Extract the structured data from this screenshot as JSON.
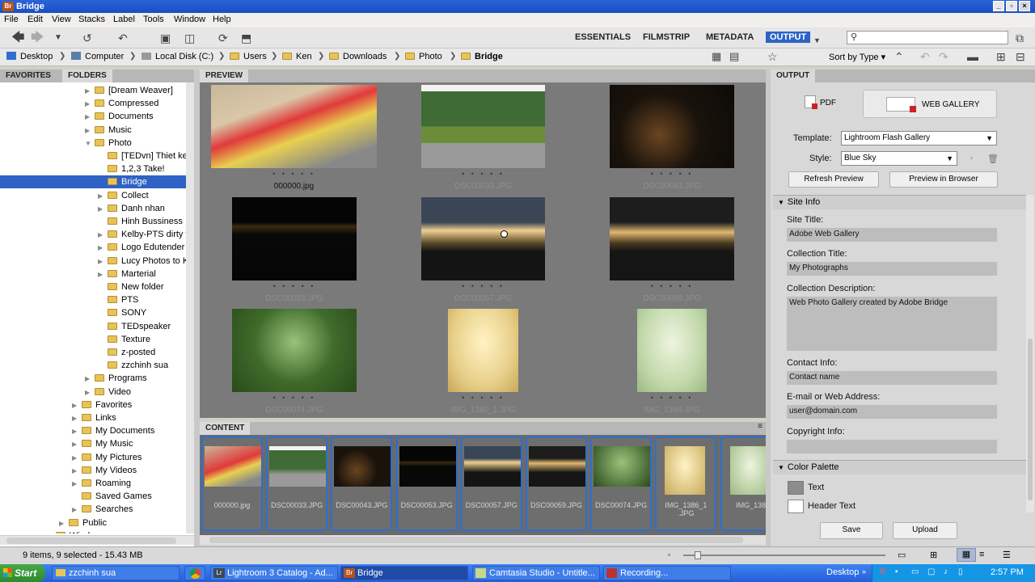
{
  "window": {
    "title": "Bridge",
    "app_icon": "Br"
  },
  "menu": [
    "File",
    "Edit",
    "View",
    "Stacks",
    "Label",
    "Tools",
    "Window",
    "Help"
  ],
  "workspaces": {
    "essentials": "ESSENTIALS",
    "filmstrip": "FILMSTRIP",
    "metadata": "METADATA",
    "output": "OUTPUT"
  },
  "path": {
    "items": [
      "Desktop",
      "Computer",
      "Local Disk (C:)",
      "Users",
      "Ken",
      "Downloads",
      "Photo",
      "Bridge"
    ],
    "sort": "Sort by Type"
  },
  "left": {
    "tabs": [
      "FAVORITES",
      "FOLDERS"
    ],
    "tree": [
      {
        "label": "[Dream Weaver]",
        "indent": 1,
        "arrow": true
      },
      {
        "label": "Compressed",
        "indent": 1,
        "arrow": true
      },
      {
        "label": "Documents",
        "indent": 1,
        "arrow": true
      },
      {
        "label": "Music",
        "indent": 1,
        "arrow": true
      },
      {
        "label": "Photo",
        "indent": 1,
        "arrow": true,
        "open": true
      },
      {
        "label": "[TEDvn] Thiet ke",
        "indent": 2,
        "arrow": false
      },
      {
        "label": "1,2,3 Take!",
        "indent": 2,
        "arrow": false
      },
      {
        "label": "Bridge",
        "indent": 2,
        "arrow": false,
        "selected": true
      },
      {
        "label": "Collect",
        "indent": 2,
        "arrow": true
      },
      {
        "label": "Danh nhan",
        "indent": 2,
        "arrow": true
      },
      {
        "label": "Hinh Bussiness",
        "indent": 2,
        "arrow": false
      },
      {
        "label": "Kelby-PTS dirty tric",
        "indent": 2,
        "arrow": true
      },
      {
        "label": "Logo Edutender",
        "indent": 2,
        "arrow": true
      },
      {
        "label": "Lucy Photos to Ken",
        "indent": 2,
        "arrow": true
      },
      {
        "label": "Marterial",
        "indent": 2,
        "arrow": true
      },
      {
        "label": "New folder",
        "indent": 2,
        "arrow": false
      },
      {
        "label": "PTS",
        "indent": 2,
        "arrow": false
      },
      {
        "label": "SONY",
        "indent": 2,
        "arrow": false
      },
      {
        "label": "TEDspeaker",
        "indent": 2,
        "arrow": false
      },
      {
        "label": "Texture",
        "indent": 2,
        "arrow": false
      },
      {
        "label": "z-posted",
        "indent": 2,
        "arrow": false
      },
      {
        "label": "zzchinh sua",
        "indent": 2,
        "arrow": false
      },
      {
        "label": "Programs",
        "indent": 1,
        "arrow": true
      },
      {
        "label": "Video",
        "indent": 1,
        "arrow": true
      },
      {
        "label": "Favorites",
        "indent": 0,
        "arrow": true
      },
      {
        "label": "Links",
        "indent": 0,
        "arrow": true
      },
      {
        "label": "My Documents",
        "indent": 0,
        "arrow": true
      },
      {
        "label": "My Music",
        "indent": 0,
        "arrow": true
      },
      {
        "label": "My Pictures",
        "indent": 0,
        "arrow": true
      },
      {
        "label": "My Videos",
        "indent": 0,
        "arrow": true
      },
      {
        "label": "Roaming",
        "indent": 0,
        "arrow": true
      },
      {
        "label": "Saved Games",
        "indent": 0,
        "arrow": false
      },
      {
        "label": "Searches",
        "indent": 0,
        "arrow": true
      },
      {
        "label": "Public",
        "indent": -1,
        "arrow": true
      },
      {
        "label": "Windows",
        "indent": -2,
        "arrow": true
      }
    ]
  },
  "preview": {
    "tab": "PREVIEW",
    "items": [
      {
        "name": "000000.jpg",
        "selected": true
      },
      {
        "name": "DSC00033.JPG"
      },
      {
        "name": "DSC00043.JPG"
      },
      {
        "name": "DSC00053.JPG"
      },
      {
        "name": "DSC00057.JPG"
      },
      {
        "name": "DSC00059.JPG"
      },
      {
        "name": "DSC00074.JPG"
      },
      {
        "name": "IMG_1380_1.JPG"
      },
      {
        "name": "IMG_1386.JPG"
      }
    ],
    "stars": "• • • • •"
  },
  "content": {
    "tab": "CONTENT",
    "items": [
      "000000.jpg",
      "DSC00033.JPG",
      "DSC00043.JPG",
      "DSC00053.JPG",
      "DSC00057.JPG",
      "DSC00059.JPG",
      "DSC00074.JPG",
      "IMG_1386_1\n.JPG",
      "IMG_138"
    ]
  },
  "output": {
    "tab": "OUTPUT",
    "pdf": "PDF",
    "web_gallery": "WEB GALLERY",
    "template_label": "Template:",
    "template_value": "Lightroom Flash Gallery",
    "style_label": "Style:",
    "style_value": "Blue Sky",
    "refresh": "Refresh Preview",
    "preview_browser": "Preview in Browser",
    "site_info": "Site Info",
    "site_title_label": "Site Title:",
    "site_title": "Adobe Web Gallery",
    "collection_title_label": "Collection Title:",
    "collection_title": "My Photographs",
    "collection_desc_label": "Collection Description:",
    "collection_desc": "Web Photo Gallery created by Adobe Bridge",
    "contact_label": "Contact Info:",
    "contact": "Contact name",
    "email_label": "E-mail or Web Address:",
    "email": "user@domain.com",
    "copyright_label": "Copyright Info:",
    "copyright": "",
    "color_palette": "Color Palette",
    "text": "Text",
    "header_text": "Header Text",
    "save": "Save",
    "upload": "Upload"
  },
  "status": {
    "text": "9 items, 9 selected - 15.43 MB"
  },
  "taskbar": {
    "start": "Start",
    "tasks": [
      "zzchinh sua",
      "",
      "Lightroom 3 Catalog - Ad...",
      "Bridge",
      "Camtasia Studio - Untitle...",
      "Recording..."
    ],
    "desktop": "Desktop",
    "time": "2:57 PM"
  }
}
